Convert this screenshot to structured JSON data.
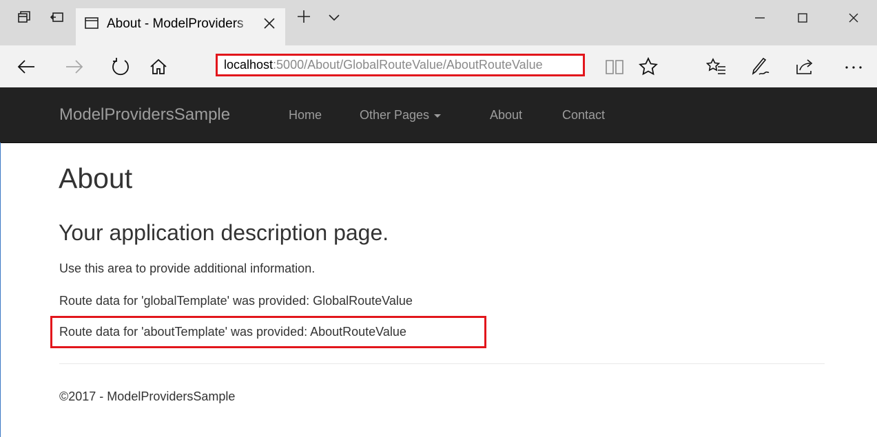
{
  "browser": {
    "tab": {
      "title": "About - ModelProviders",
      "close_icon": "close-icon",
      "page_icon": "page-icon"
    },
    "new_tab_icon": "plus-icon",
    "tab_list_icon": "chevron-down-icon",
    "window_controls": [
      "minimize-icon",
      "maximize-icon",
      "close-icon"
    ],
    "address": {
      "host": "localhost",
      "path": ":5000/About/GlobalRouteValue/AboutRouteValue"
    },
    "highlight_color": "#e2161c"
  },
  "site": {
    "brand": "ModelProvidersSample",
    "nav": {
      "home": "Home",
      "other_pages": "Other Pages",
      "about": "About",
      "contact": "Contact"
    },
    "navbar_color": "#222222"
  },
  "page": {
    "title": "About",
    "subtitle": "Your application description page.",
    "info": "Use this area to provide additional information.",
    "global_route": "Route data for 'globalTemplate' was provided: GlobalRouteValue",
    "about_route": "Route data for 'aboutTemplate' was provided: AboutRouteValue"
  },
  "footer": {
    "text": "©2017 - ModelProvidersSample"
  }
}
